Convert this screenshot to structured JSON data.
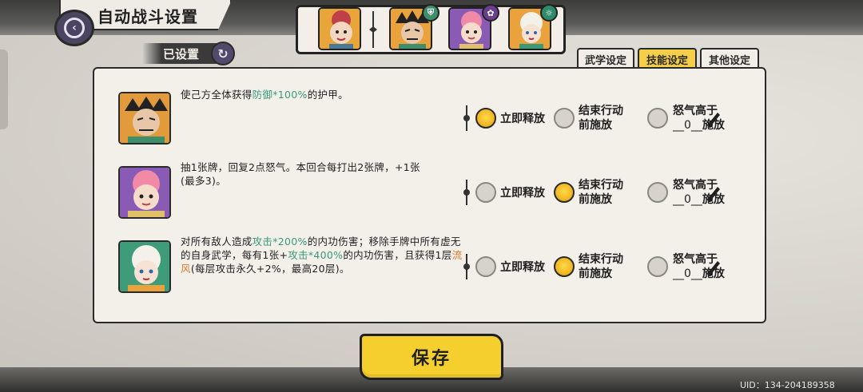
{
  "header": {
    "title": "自动战斗设置",
    "status_badge": "已设置"
  },
  "team": {
    "members": [
      {
        "name": "leader-portrait",
        "color": "#e8a53a"
      },
      {
        "name": "member-1",
        "color": "#3c8f6a",
        "badge": "shield-icon"
      },
      {
        "name": "member-2",
        "color": "#7e55a8",
        "badge": "flower-icon"
      },
      {
        "name": "member-3",
        "color": "#3a9a78",
        "badge": "swirl-icon"
      }
    ]
  },
  "tabs": [
    {
      "label": "武学设定",
      "active": false
    },
    {
      "label": "技能设定",
      "active": true
    },
    {
      "label": "其他设定",
      "active": false
    }
  ],
  "skills": [
    {
      "desc_parts": [
        "使己方全体获得",
        "防御*100%",
        "的护甲。"
      ],
      "selected": 0,
      "icon_bg": "#e39a3a"
    },
    {
      "desc_parts": [
        "抽1张牌，回复2点怒气。本回合每打出2张牌，+1张",
        "(最多3)。"
      ],
      "selected": 1,
      "icon_bg": "#8a5bb5"
    },
    {
      "desc_parts": [
        "对所有敌人造成",
        "攻击*200%",
        "的内功伤害；移除手牌中所有虚无的自身武学，每有1张+",
        "攻击*400%",
        "的内功伤害，且获得1层",
        "流风",
        "(每层攻击永久+2%，最高20层)。"
      ],
      "selected": 1,
      "icon_bg": "#3f9c7a"
    }
  ],
  "options": {
    "immediate": "立即释放",
    "before_end_line1": "结束行动",
    "before_end_line2": "前施放",
    "rage_line1": "怒气高于",
    "rage_value": "__0__",
    "rage_suffix": "施放"
  },
  "save_label": "保存",
  "uid": "UID：134-204189358"
}
